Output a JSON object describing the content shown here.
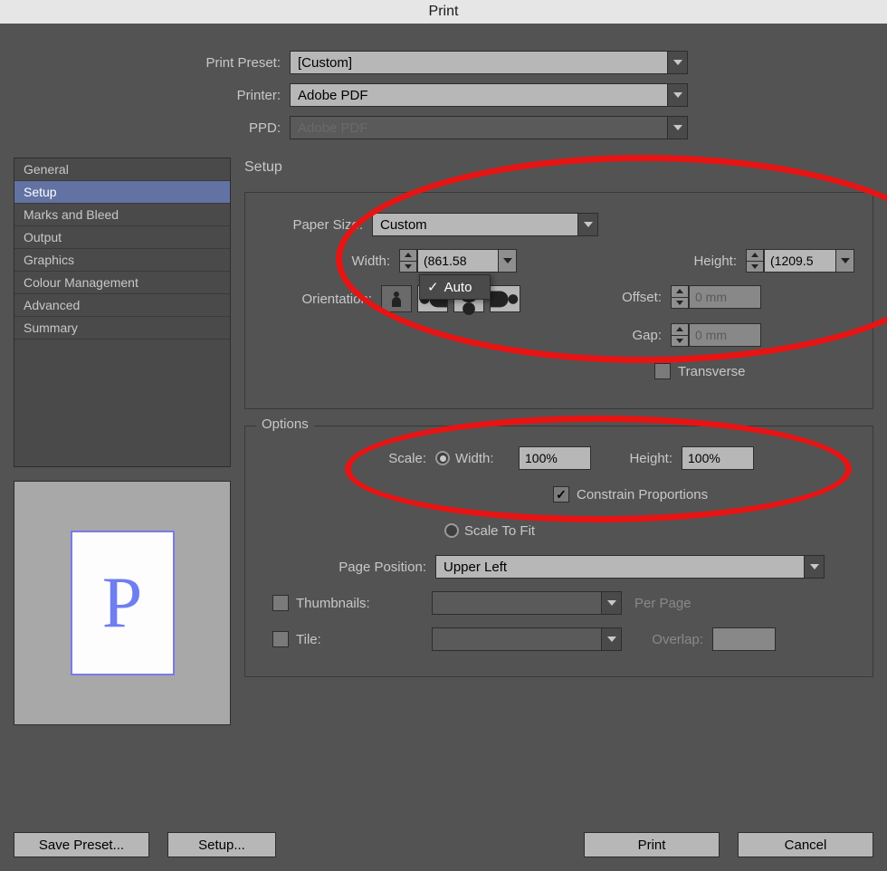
{
  "title": "Print",
  "header": {
    "preset_label": "Print Preset:",
    "preset_value": "[Custom]",
    "printer_label": "Printer:",
    "printer_value": "Adobe PDF",
    "ppd_label": "PPD:",
    "ppd_value": "Adobe PDF"
  },
  "sidebar": {
    "items": [
      {
        "label": "General"
      },
      {
        "label": "Setup"
      },
      {
        "label": "Marks and Bleed"
      },
      {
        "label": "Output"
      },
      {
        "label": "Graphics"
      },
      {
        "label": "Colour Management"
      },
      {
        "label": "Advanced"
      },
      {
        "label": "Summary"
      }
    ],
    "selected_index": 1
  },
  "setup": {
    "title": "Setup",
    "paper_size_label": "Paper Size:",
    "paper_size_value": "Custom",
    "width_label": "Width:",
    "width_value": "(861.58",
    "width_popup": "Auto",
    "height_label": "Height:",
    "height_value": "(1209.5",
    "orientation_label": "Orientation:",
    "offset_label": "Offset:",
    "offset_value": "0 mm",
    "gap_label": "Gap:",
    "gap_value": "0 mm",
    "transverse_label": "Transverse",
    "transverse_checked": false
  },
  "options": {
    "title": "Options",
    "scale_label": "Scale:",
    "scale_width_label": "Width:",
    "scale_width_value": "100%",
    "scale_height_label": "Height:",
    "scale_height_value": "100%",
    "constrain_label": "Constrain Proportions",
    "constrain_checked": true,
    "scale_to_fit_label": "Scale To Fit",
    "page_position_label": "Page Position:",
    "page_position_value": "Upper Left",
    "thumbnails_label": "Thumbnails:",
    "thumbnails_checked": false,
    "per_page_label": "Per Page",
    "tile_label": "Tile:",
    "tile_checked": false,
    "overlap_label": "Overlap:"
  },
  "preview_glyph": "P",
  "footer": {
    "save_preset": "Save Preset...",
    "setup": "Setup...",
    "print": "Print",
    "cancel": "Cancel"
  }
}
